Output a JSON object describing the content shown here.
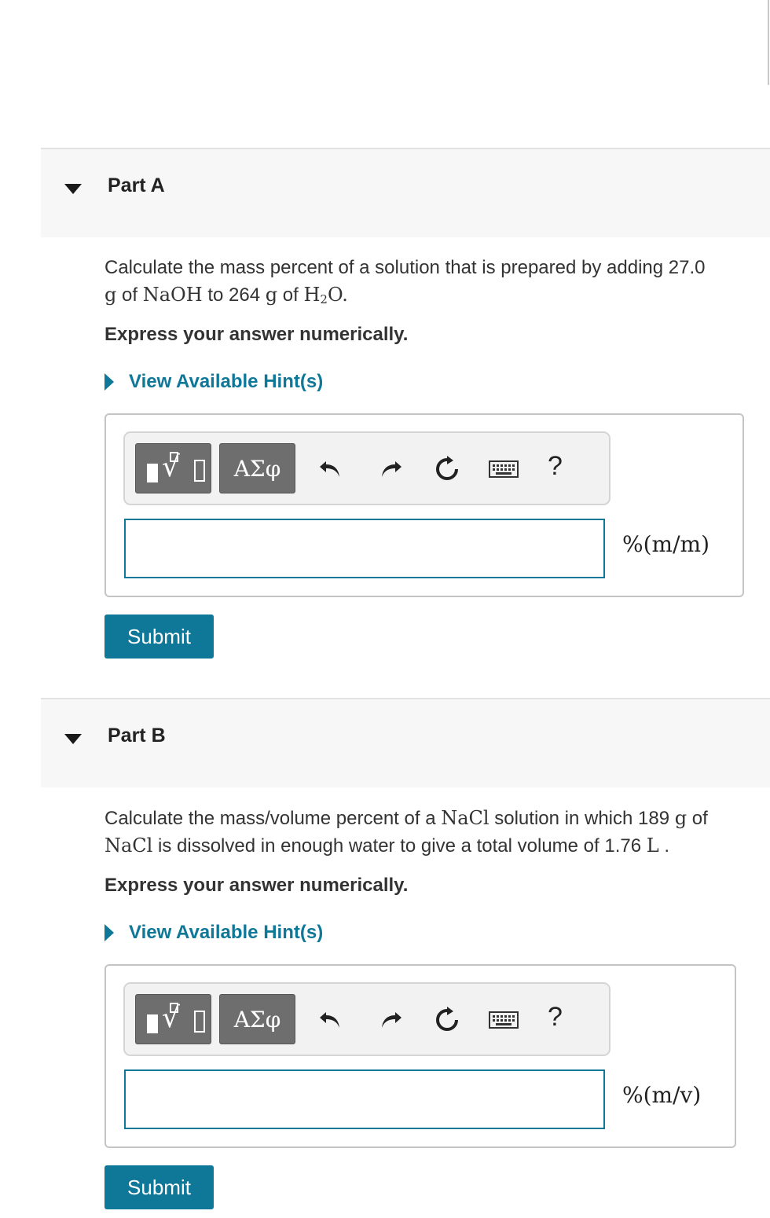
{
  "part_a": {
    "title": "Part A",
    "question": {
      "t1": "Calculate the mass percent of a solution that is prepared by adding 27.0",
      "m1": "g",
      "t2": " of ",
      "m2": "NaOH",
      "t3": " to 264 ",
      "m3": "g",
      "t4": " of ",
      "m4a": "H",
      "m4sub": "2",
      "m4b": "O",
      "t5": "."
    },
    "instruction": "Express your answer numerically.",
    "hint_link": "View Available Hint(s)",
    "toolbar": {
      "greek_label": "ΑΣφ",
      "help_label": "?"
    },
    "input_value": "",
    "unit": "%(m/m)",
    "submit_label": "Submit"
  },
  "part_b": {
    "title": "Part B",
    "question": {
      "t1": "Calculate the mass/volume percent of a ",
      "m1": "NaCl",
      "t2": " solution in which 189 ",
      "m2": "g",
      "t3": " of",
      "m3": "NaCl",
      "t4": " is dissolved in enough water to give a total volume of 1.76 ",
      "m4": "L",
      "t5": " ."
    },
    "instruction": "Express your answer numerically.",
    "hint_link": "View Available Hint(s)",
    "toolbar": {
      "greek_label": "ΑΣφ",
      "help_label": "?"
    },
    "input_value": "",
    "unit": "%(m/v)",
    "submit_label": "Submit"
  }
}
